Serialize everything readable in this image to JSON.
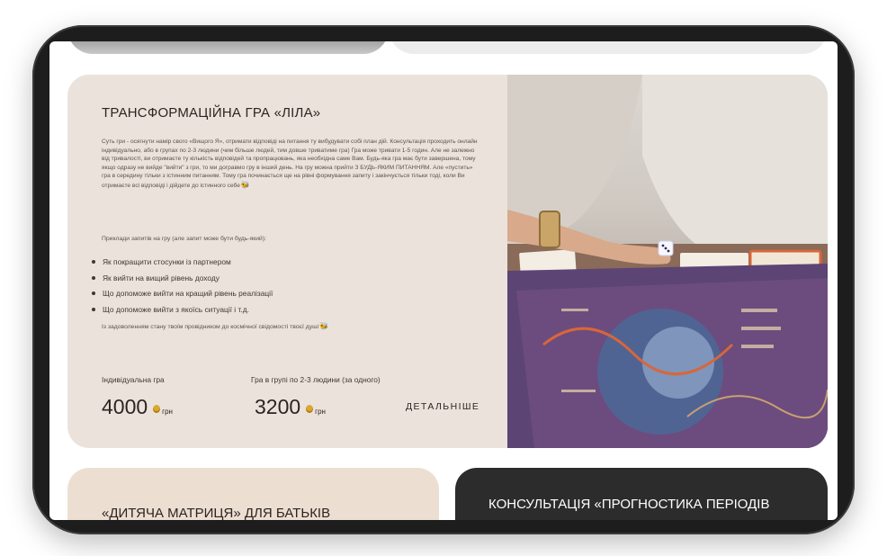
{
  "main_card": {
    "title": "ТРАНСФОРМАЦІЙНА ГРА «ЛІЛА»",
    "description": "Суть гри - осягнути намір свого «Вищого Я», отримати відповіді на питання ту вибудувати собі план дій. Консультація проходить онлайн індивідуально, або в групах по 2-3 людини (чим більше людей, тим довше триватиме гра) Гра може тривати 1-5 годин. Але не залежно від тривалості, ви отримаєте ту кількість відповідей та пропрацювань, яка необхідна саме Вам. Будь-яка гра має бути завершена, тому якщо одразу не вийде \"вийти\" з гри, то ми догравмо гру в інший день. На гру можна прийти З БУДЬ-ЯКИМ ПИТАННЯМ. Але «пустить» гра в середину тільки з істинним питанням. Тому гра починається ще на рівні формування запиту і закінчується тільки тоді, коли Ви отримаєте всі відповіді і дійдете до істинного себе",
    "examples_label": "Приклади запитів на гру (але запит може бути будь-який):",
    "examples": [
      "Як покращити стосунки із партнером",
      "Як вийти на вищий рівень доходу",
      "Що допоможе вийти на кращий рівень реалізації",
      "Що допоможе вийти з якоїсь ситуації і т.д."
    ],
    "closing": "Із задоволенням стану твоїм провідником до космічної свідомості твоєї душі",
    "individual_label": "Індивідуальна гра",
    "individual_price": "4000",
    "group_label": "Гра в групі по 2-3 людини (за одного)",
    "group_price": "3200",
    "currency": "грн",
    "more_label": "ДЕТАЛЬНІШЕ"
  },
  "card_children": {
    "title": "«ДИТЯЧА МАТРИЦЯ» ДЛЯ БАТЬКІВ"
  },
  "card_prognostic": {
    "title": "КОНСУЛЬТАЦІЯ «ПРОГНОСТИКА ПЕРІОДІВ"
  },
  "colors": {
    "card_bg": "#ebe3db",
    "dark_card_bg": "#2c2c2c",
    "text": "#2c2420",
    "coin": "#d9a82e"
  },
  "icons": [
    "bee-icon",
    "coin-icon"
  ]
}
